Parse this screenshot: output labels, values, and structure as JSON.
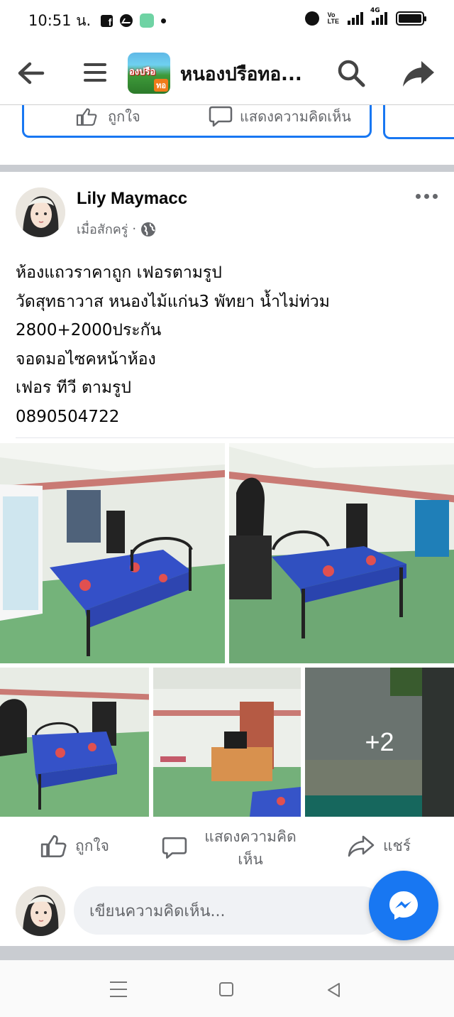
{
  "status_bar": {
    "time": "10:51 น.",
    "network": "4G",
    "volte_line1": "Vo",
    "volte_line2": "LTE"
  },
  "header": {
    "page_title": "หนองปรือทอ...",
    "thumb_text": "องปรือ",
    "thumb_badge": "ทอ"
  },
  "previous_post": {
    "like_label": "ถูกใจ",
    "comment_label": "แสดงความคิดเห็น"
  },
  "post": {
    "author": "Lily Maymacc",
    "time": "เมื่อสักครู่",
    "separator": "·",
    "text_lines": [
      "ห้องแถวราคาถูก เฟอรตามรูป",
      "วัดสุทธาวาส หนองไม้แก่น3 พัทยา น้ำไม่ท่วม",
      "2800+2000ประกัน",
      "จอดมอไซคหน้าห้อง",
      "เฟอร   ทีวี ตามรูป",
      "0890504722"
    ],
    "more_photos": "+2"
  },
  "actions": {
    "like": "ถูกใจ",
    "comment": "แสดงความคิดเห็น",
    "share": "แชร์"
  },
  "composer": {
    "placeholder": "เขียนความคิดเห็น..."
  },
  "colors": {
    "accent": "#1877f2",
    "secondary_text": "#65676b",
    "divider": "#c9ccd1"
  }
}
